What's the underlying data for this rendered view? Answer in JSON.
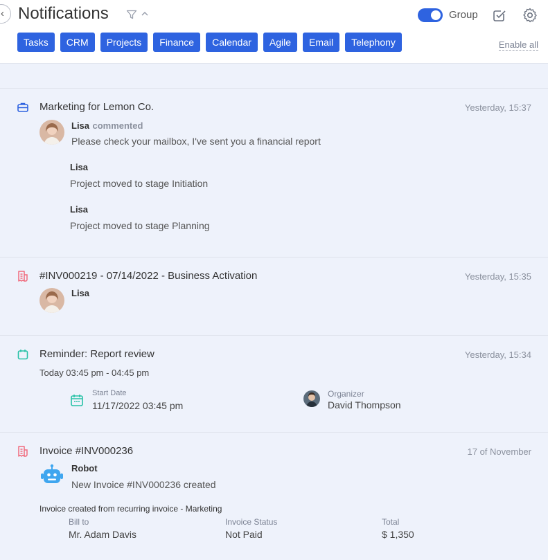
{
  "header": {
    "title": "Notifications",
    "group_label": "Group",
    "group_enabled": true,
    "enable_all_label": "Enable all",
    "categories": [
      "Tasks",
      "CRM",
      "Projects",
      "Finance",
      "Calendar",
      "Agile",
      "Email",
      "Telephony"
    ]
  },
  "colors": {
    "accent": "#2e63e0",
    "finance_icon": "#f06b7c",
    "calendar_icon": "#27c1a6",
    "project_icon": "#2e63e0",
    "robot": "#3fa6ef"
  },
  "notifications": [
    {
      "icon": "briefcase-icon",
      "title": "Marketing for Lemon Co.",
      "time": "Yesterday, 15:37",
      "comment": {
        "author": "Lisa",
        "action": "commented",
        "text": "Please check your mailbox, I've sent you a financial report"
      },
      "events": [
        {
          "author": "Lisa",
          "text": "Project moved to stage Initiation"
        },
        {
          "author": "Lisa",
          "text": "Project moved to stage Planning"
        }
      ]
    },
    {
      "icon": "invoice-icon",
      "title": "#INV000219 - 07/14/2022 - Business Activation",
      "time": "Yesterday, 15:35",
      "author": "Lisa"
    },
    {
      "icon": "calendar-icon",
      "title": "Reminder: Report review",
      "time": "Yesterday, 15:34",
      "subtitle": "Today 03:45 pm - 04:45 pm",
      "start_date_label": "Start Date",
      "start_date": "11/17/2022 03:45 pm",
      "organizer_label": "Organizer",
      "organizer": "David Thompson"
    },
    {
      "icon": "invoice-icon",
      "title": "Invoice #INV000236",
      "time": "17 of November",
      "author": "Robot",
      "text": "New Invoice #INV000236 created",
      "note": "Invoice created from recurring invoice - Marketing",
      "bill_to_label": "Bill to",
      "bill_to": "Mr. Adam Davis",
      "status_label": "Invoice Status",
      "status": "Not Paid",
      "total_label": "Total",
      "total": "$ 1,350"
    }
  ]
}
